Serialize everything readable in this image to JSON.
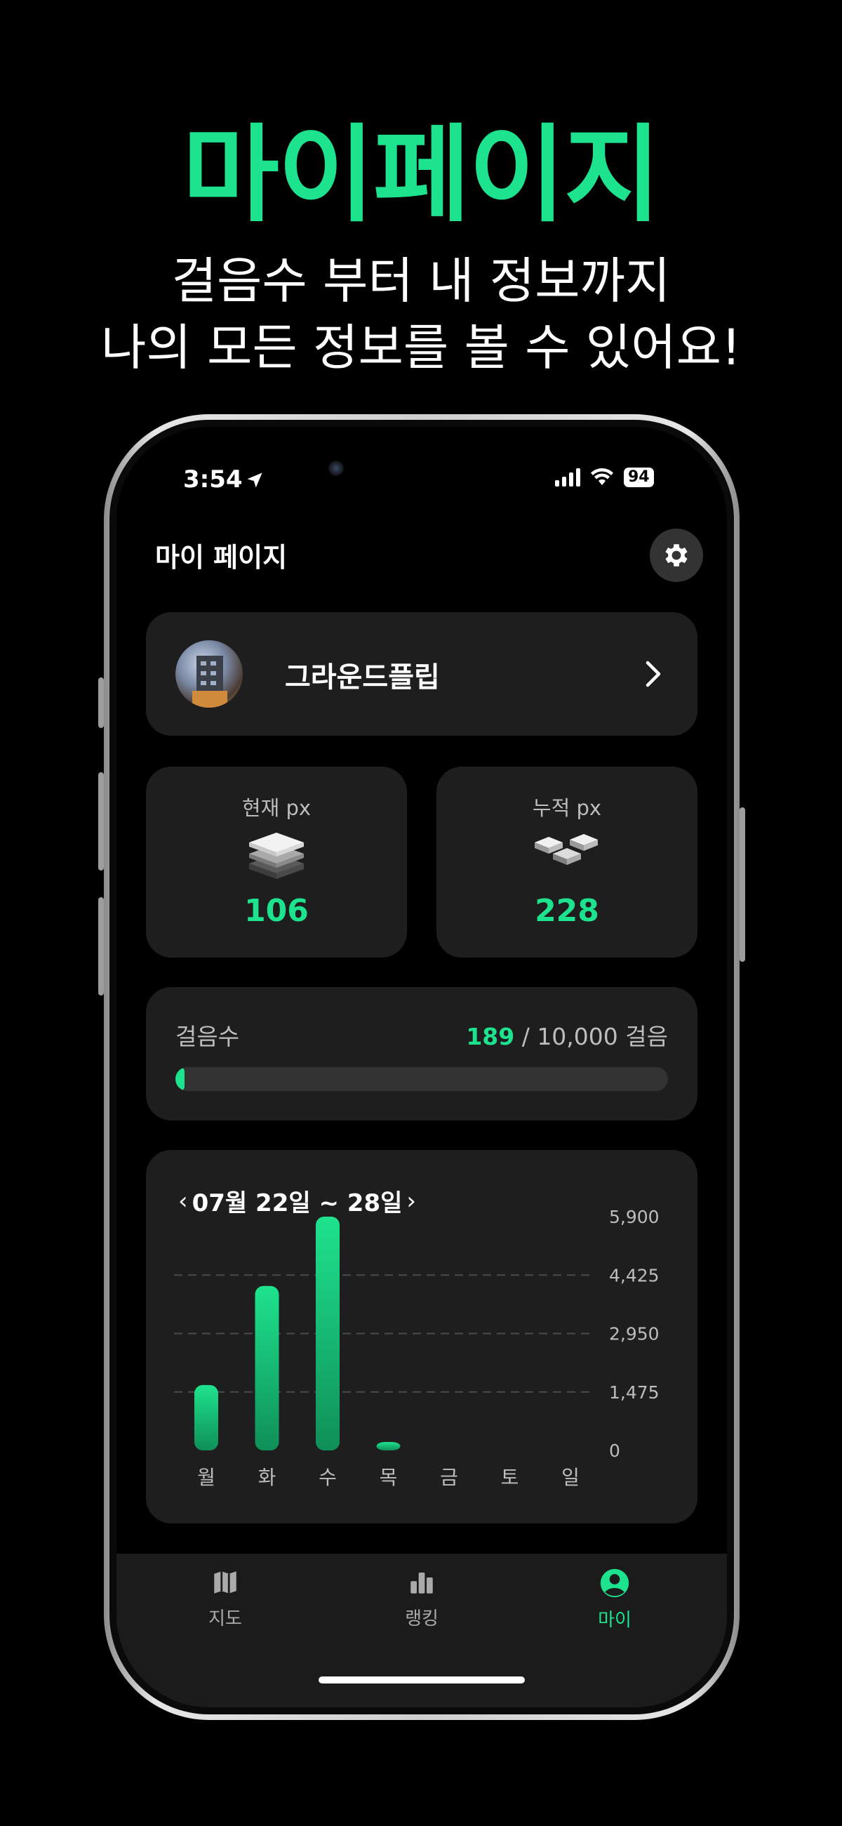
{
  "promo": {
    "title": "마이페이지",
    "subtitle_line1": "걸음수 부터 내 정보까지",
    "subtitle_line2": "나의 모든 정보를 볼 수 있어요!"
  },
  "status_bar": {
    "time": "3:54",
    "battery": "94"
  },
  "header": {
    "title": "마이 페이지",
    "settings_icon": "gear-icon"
  },
  "profile": {
    "name": "그라운드플립"
  },
  "stats": {
    "current": {
      "label": "현재 px",
      "value": "106"
    },
    "accumulated": {
      "label": "누적 px",
      "value": "228"
    }
  },
  "steps": {
    "label": "걸음수",
    "count": "189",
    "goal_text": " / 10,000 걸음",
    "progress": 0.0189
  },
  "chart": {
    "range_label": "07월 22일 ~ 28일"
  },
  "chart_data": {
    "type": "bar",
    "categories": [
      "월",
      "화",
      "수",
      "목",
      "금",
      "토",
      "일"
    ],
    "values": [
      1650,
      4150,
      5900,
      180,
      0,
      0,
      0
    ],
    "ylim": [
      0,
      5900
    ],
    "yticks": [
      "0",
      "1,475",
      "2,950",
      "4,425",
      "5,900"
    ],
    "grid": true,
    "colors": {
      "bar_top": "#1ee38e",
      "bar_bottom": "#0f8f58"
    }
  },
  "tabbar": {
    "items": [
      {
        "label": "지도",
        "icon": "map-icon"
      },
      {
        "label": "랭킹",
        "icon": "ranking-icon"
      },
      {
        "label": "마이",
        "icon": "profile-icon",
        "active": true
      }
    ]
  },
  "colors": {
    "accent": "#1ee38e",
    "card": "#1e1e1e",
    "background": "#000000"
  }
}
